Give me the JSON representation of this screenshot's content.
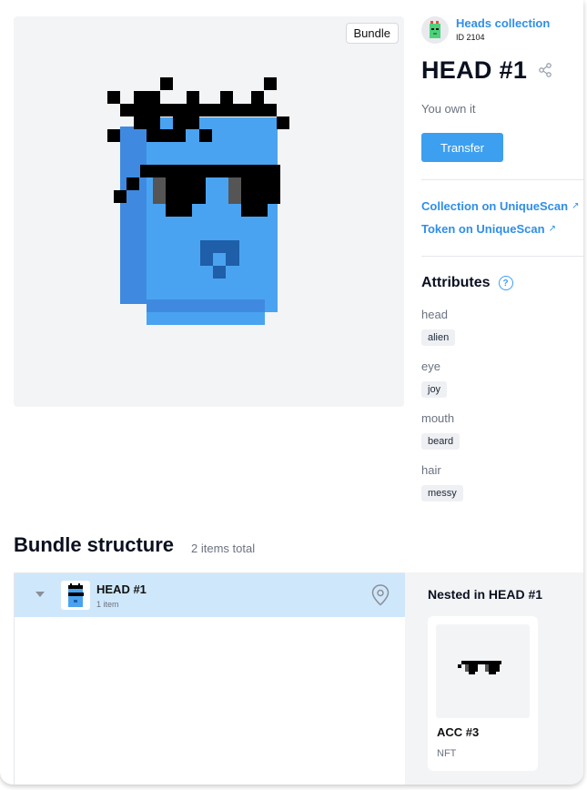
{
  "image_panel": {
    "badge": "Bundle",
    "art_icon": "pixel-head-art"
  },
  "collection": {
    "name": "Heads collection",
    "id_label": "ID 2104",
    "avatar_icon": "green-pixel-head-avatar"
  },
  "token": {
    "title": "HEAD #1",
    "share_icon": "share-icon",
    "owner_note": "You own it",
    "transfer_label": "Transfer"
  },
  "links": {
    "collection_scan": "Collection on UniqueScan",
    "token_scan": "Token on UniqueScan",
    "arrow": "↗"
  },
  "attributes": {
    "heading": "Attributes",
    "help": "?",
    "items": [
      {
        "label": "head",
        "value": "alien"
      },
      {
        "label": "eye",
        "value": "joy"
      },
      {
        "label": "mouth",
        "value": "beard"
      },
      {
        "label": "hair",
        "value": "messy"
      }
    ]
  },
  "bundle": {
    "title": "Bundle structure",
    "count": "2 items total",
    "tree": {
      "name": "HEAD #1",
      "sub": "1 item"
    },
    "nested": {
      "title": "Nested in HEAD #1",
      "card_name": "ACC #3",
      "card_type": "NFT"
    }
  },
  "colors": {
    "accent": "#3d9ff0",
    "link": "#2f8ee8",
    "selected_row": "#cfe7fb",
    "head_blue": "#4aa3f0",
    "head_dark_blue": "#3f8ae0"
  }
}
